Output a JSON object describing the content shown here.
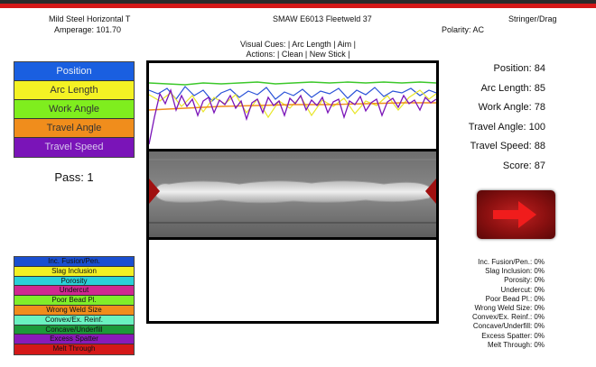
{
  "header": {
    "material": "Mild Steel Horizontal T",
    "amperage": "Amperage: 101.70",
    "process": "SMAW E6013 Fleetweld 37",
    "technique": "Stringer/Drag",
    "polarity": "Polarity: AC"
  },
  "cues": {
    "visual_label": "Visual Cues:",
    "visual_items": [
      "| Arc Length",
      "| Aim",
      "|"
    ],
    "actions_label": "Actions:",
    "action_items": [
      "| Clean",
      "| New Stick |"
    ]
  },
  "parameters": [
    {
      "label": "Position",
      "color": "#1a5fe0"
    },
    {
      "label": "Arc Length",
      "color": "#f4f224"
    },
    {
      "label": "Work Angle",
      "color": "#7fee1e"
    },
    {
      "label": "Travel Angle",
      "color": "#f08d1c"
    },
    {
      "label": "Travel Speed",
      "color": "#7a14b8"
    }
  ],
  "pass": "Pass: 1",
  "scores": [
    "Position: 84",
    "Arc Length: 85",
    "Work Angle: 78",
    "Travel Angle: 100",
    "Travel Speed: 88",
    "Score: 87"
  ],
  "defect_legend": [
    {
      "label": "Inc. Fusion/Pen.",
      "color": "#1a4fd0"
    },
    {
      "label": "Slag Inclusion",
      "color": "#f2f024"
    },
    {
      "label": "Porosity",
      "color": "#2ad0d8"
    },
    {
      "label": "Undercut",
      "color": "#d02890"
    },
    {
      "label": "Poor Bead Pl.",
      "color": "#80ee2a"
    },
    {
      "label": "Wrong Weld Size",
      "color": "#f08d1c"
    },
    {
      "label": "Convex/Ex. Reinf.",
      "color": "#6af2c0"
    },
    {
      "label": "Concave/Underfill",
      "color": "#1c9a3a"
    },
    {
      "label": "Excess Spatter",
      "color": "#8a1ab8"
    },
    {
      "label": "Melt Through",
      "color": "#d41818"
    }
  ],
  "defect_percents": [
    "Inc. Fusion/Pen.: 0%",
    "Slag Inclusion: 0%",
    "Porosity: 0%",
    "Undercut: 0%",
    "Poor Bead Pl.: 0%",
    "Wrong Weld Size: 0%",
    "Convex/Ex. Reinf.: 0%",
    "Concave/Underfill: 0%",
    "Excess Spatter: 0%",
    "Melt Through: 0%"
  ],
  "next_button_icon": "arrow-right-icon"
}
